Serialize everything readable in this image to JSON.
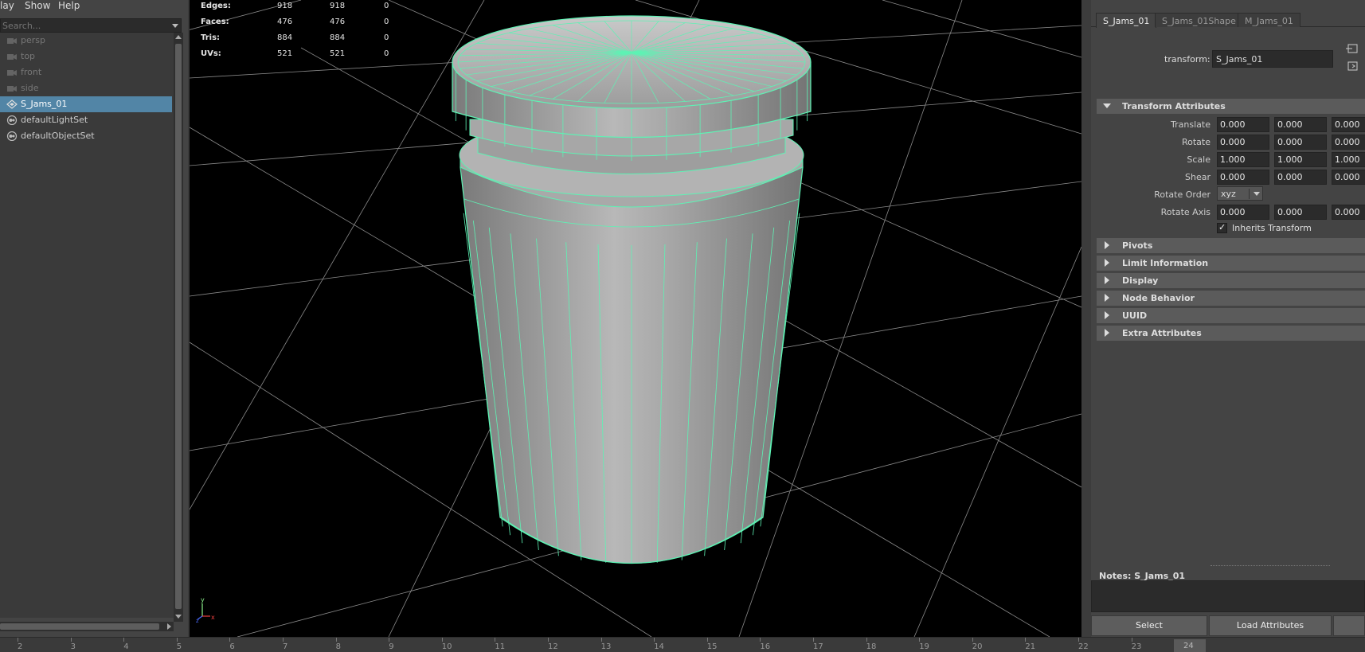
{
  "outliner": {
    "menu": [
      "lay",
      "Show",
      "Help"
    ],
    "search_placeholder": "Search...",
    "items": [
      {
        "label": "persp",
        "icon": "camera-icon",
        "dim": true
      },
      {
        "label": "top",
        "icon": "camera-icon",
        "dim": true
      },
      {
        "label": "front",
        "icon": "camera-icon",
        "dim": true
      },
      {
        "label": "side",
        "icon": "camera-icon",
        "dim": true
      },
      {
        "label": "S_Jams_01",
        "icon": "mesh-transform-icon",
        "selected": true
      },
      {
        "label": "defaultLightSet",
        "icon": "set-icon"
      },
      {
        "label": "defaultObjectSet",
        "icon": "set-icon"
      }
    ]
  },
  "hud": {
    "rows": [
      {
        "key": "Edges:",
        "a": "918",
        "b": "918",
        "c": "0"
      },
      {
        "key": "Faces:",
        "a": "476",
        "b": "476",
        "c": "0"
      },
      {
        "key": "Tris:",
        "a": "884",
        "b": "884",
        "c": "0"
      },
      {
        "key": "UVs:",
        "a": "521",
        "b": "521",
        "c": "0"
      }
    ],
    "axis": {
      "y": "y",
      "z": "z",
      "x": "x"
    }
  },
  "colors": {
    "wireframe": "#5ef2b4",
    "selected_row": "#5285a6",
    "viewport_bg": "#000000",
    "grid": "#8a8a8a"
  },
  "attribute_editor": {
    "tabs": [
      "S_Jams_01",
      "S_Jams_01Shape",
      "M_Jams_01"
    ],
    "active_tab": 0,
    "transform_label": "transform:",
    "transform_value": "S_Jams_01",
    "sections": {
      "transform": "Transform Attributes",
      "pivots": "Pivots",
      "limit": "Limit Information",
      "display": "Display",
      "node_behavior": "Node Behavior",
      "uuid": "UUID",
      "extra": "Extra Attributes"
    },
    "attributes": {
      "translate": {
        "label": "Translate",
        "values": [
          "0.000",
          "0.000",
          "0.000"
        ]
      },
      "rotate": {
        "label": "Rotate",
        "values": [
          "0.000",
          "0.000",
          "0.000"
        ]
      },
      "scale": {
        "label": "Scale",
        "values": [
          "1.000",
          "1.000",
          "1.000"
        ]
      },
      "shear": {
        "label": "Shear",
        "values": [
          "0.000",
          "0.000",
          "0.000"
        ]
      },
      "rotate_order": {
        "label": "Rotate Order",
        "value": "xyz"
      },
      "rotate_axis": {
        "label": "Rotate Axis",
        "values": [
          "0.000",
          "0.000",
          "0.000"
        ]
      }
    },
    "inherits_transform": {
      "label": "Inherits Transform",
      "checked": true
    },
    "notes_label": "Notes:  S_Jams_01",
    "buttons": {
      "select": "Select",
      "load": "Load Attributes"
    }
  },
  "timeline": {
    "ticks": [
      "2",
      "3",
      "4",
      "5",
      "6",
      "7",
      "8",
      "9",
      "10",
      "11",
      "12",
      "13",
      "14",
      "15",
      "16",
      "17",
      "18",
      "19",
      "20",
      "21",
      "22",
      "23"
    ],
    "current": "24"
  }
}
